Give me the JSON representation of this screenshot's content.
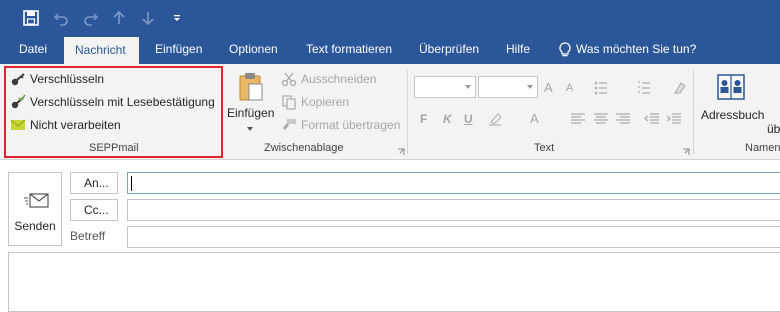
{
  "quick_access": {
    "icons": [
      "save-icon",
      "undo-icon",
      "redo-icon",
      "arrow-up-icon",
      "arrow-down-icon",
      "customize-icon"
    ]
  },
  "tabs": [
    {
      "label": "Datei"
    },
    {
      "label": "Nachricht",
      "active": true
    },
    {
      "label": "Einfügen"
    },
    {
      "label": "Optionen"
    },
    {
      "label": "Text formatieren"
    },
    {
      "label": "Überprüfen"
    },
    {
      "label": "Hilfe"
    }
  ],
  "tell_me": "Was möchten Sie tun?",
  "ribbon": {
    "seppmail": {
      "label": "SEPPmail",
      "encrypt": "Verschlüsseln",
      "encrypt_receipt": "Verschlüsseln mit Lesebestätigung",
      "no_process": "Nicht verarbeiten"
    },
    "clipboard": {
      "label": "Zwischenablage",
      "paste": "Einfügen",
      "cut": "Ausschneiden",
      "copy": "Kopieren",
      "format_painter": "Format übertragen"
    },
    "text": {
      "label": "Text",
      "bold": "F",
      "italic": "K",
      "underline": "U",
      "font_color": "A",
      "grow": "A",
      "shrink": "A"
    },
    "names": {
      "label": "Namen",
      "address_book": "Adressbuch",
      "check_names_partial": "üb"
    }
  },
  "compose": {
    "send": "Senden",
    "to": "An...",
    "cc": "Cc...",
    "subject": "Betreff"
  },
  "colors": {
    "brand": "#2b579a",
    "highlight": "#e0262b"
  }
}
